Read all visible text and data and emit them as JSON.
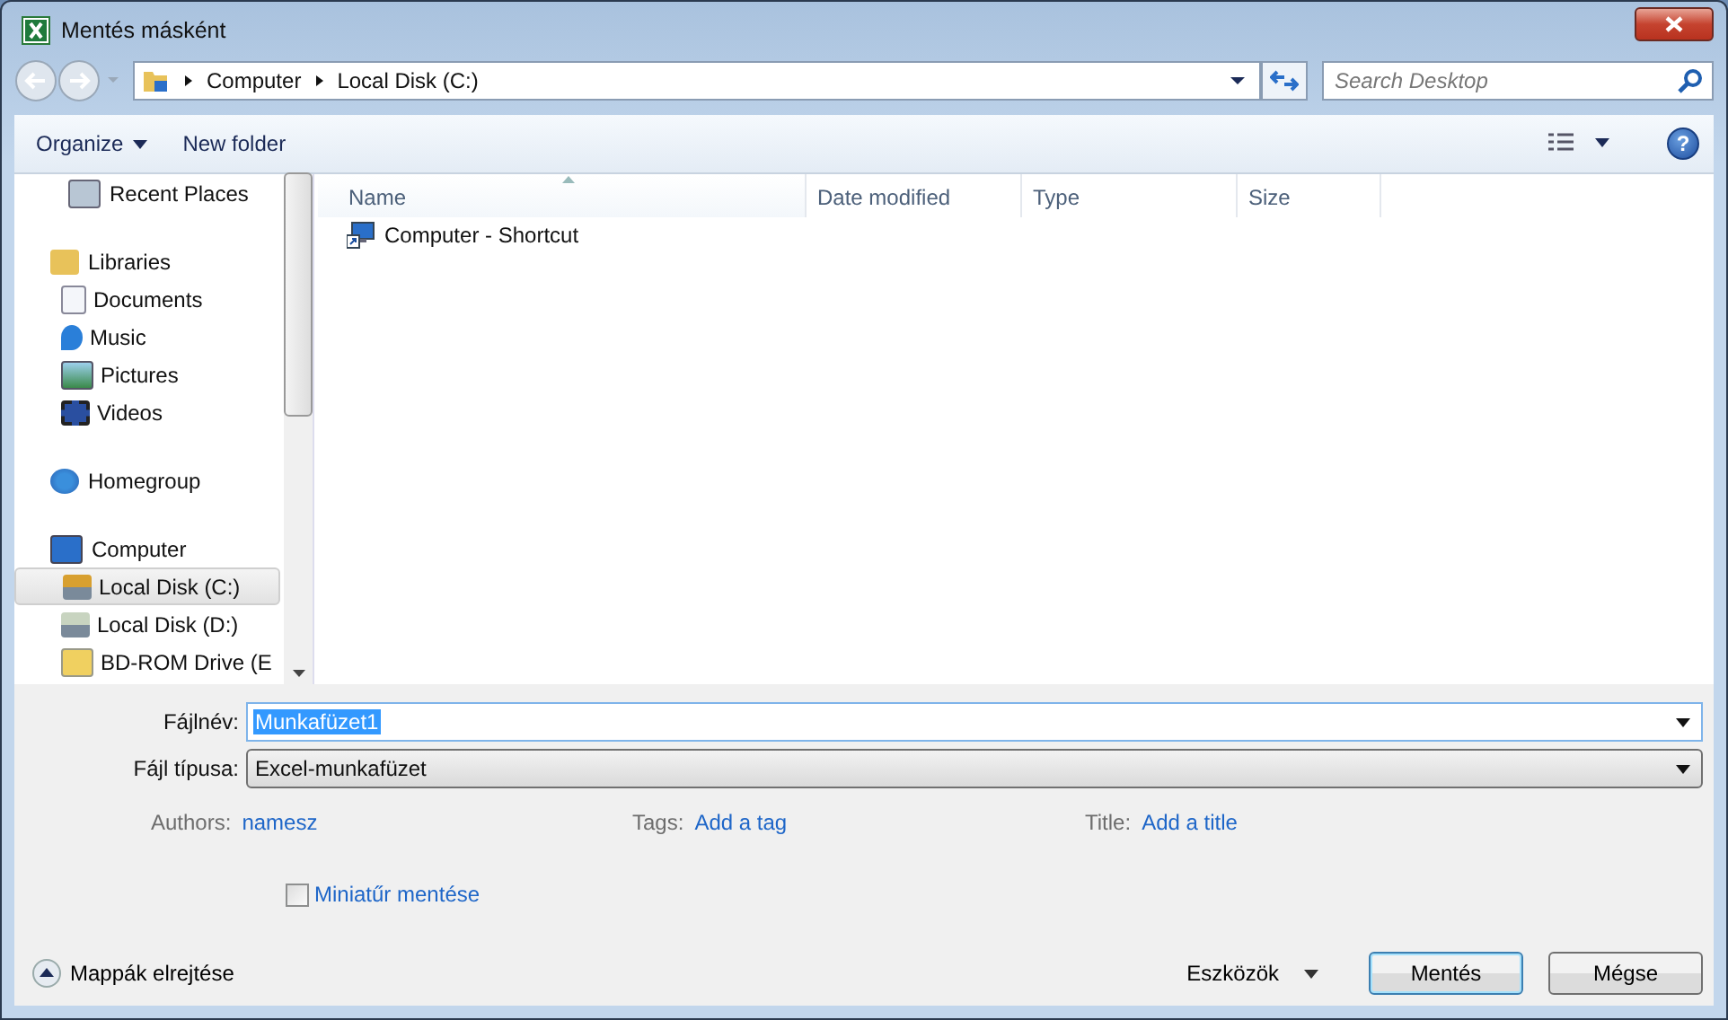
{
  "window": {
    "title": "Mentés másként"
  },
  "address_bar": {
    "crumbs": [
      "Computer",
      "Local Disk (C:)"
    ]
  },
  "search": {
    "placeholder": "Search Desktop"
  },
  "toolbar": {
    "organize": "Organize",
    "new_folder": "New folder",
    "help": "?"
  },
  "sidebar": {
    "items": [
      {
        "label": "Recent Places",
        "selected": false
      },
      {
        "label": "Libraries",
        "selected": false,
        "children": [
          {
            "label": "Documents",
            "selected": false
          },
          {
            "label": "Music",
            "selected": false
          },
          {
            "label": "Pictures",
            "selected": false
          },
          {
            "label": "Videos",
            "selected": false
          }
        ]
      },
      {
        "label": "Homegroup",
        "selected": false
      },
      {
        "label": "Computer",
        "selected": false,
        "children": [
          {
            "label": "Local Disk (C:)",
            "selected": true
          },
          {
            "label": "Local Disk (D:)",
            "selected": false
          },
          {
            "label": "BD-ROM Drive (E",
            "selected": false
          }
        ]
      }
    ]
  },
  "table": {
    "columns": [
      {
        "label": "Name",
        "sorted": true
      },
      {
        "label": "Date modified",
        "sorted": false
      },
      {
        "label": "Type",
        "sorted": false
      },
      {
        "label": "Size",
        "sorted": false
      }
    ],
    "rows": [
      {
        "name": "Computer - Shortcut"
      }
    ]
  },
  "form": {
    "filename_label": "Fájlnév:",
    "filename": "Munkafüzet1",
    "type_label": "Fájl típusa:",
    "type": "Excel-munkafüzet"
  },
  "metadata": [
    {
      "label": "Authors:",
      "value": "namesz"
    },
    {
      "label": "Tags:",
      "value": "Add a tag"
    },
    {
      "label": "Title:",
      "value": "Add a title"
    }
  ],
  "thumbnail": {
    "label": "Miniatűr mentése",
    "checked": false
  },
  "footer": {
    "hide_folders": "Mappák elrejtése",
    "tools": "Eszközök",
    "save": "Mentés",
    "cancel": "Mégse"
  }
}
